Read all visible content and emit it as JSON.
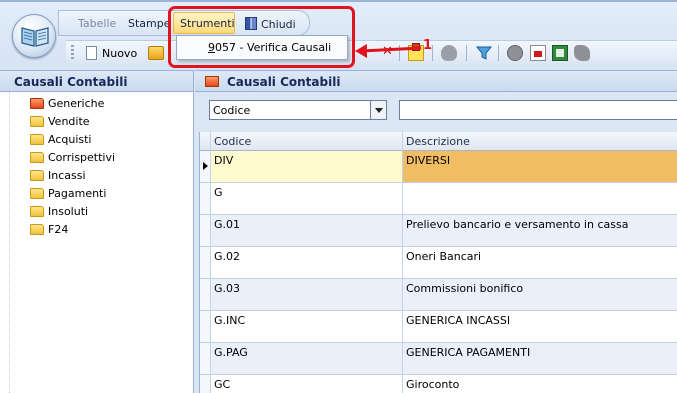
{
  "ribbon": {
    "tabs": [
      "Tabelle",
      "Stampe",
      "Strumenti",
      "Chiudi"
    ],
    "active_tab": "Strumenti"
  },
  "toolbar": {
    "new_label": "Nuovo"
  },
  "strumenti_menu": {
    "items": [
      "9057 - Verifica Causali"
    ]
  },
  "callout": {
    "number": "1",
    "color": "#e0131e"
  },
  "left_pane": {
    "title": "Causali Contabili",
    "items": [
      "Generiche",
      "Vendite",
      "Acquisti",
      "Corrispettivi",
      "Incassi",
      "Pagamenti",
      "Insoluti",
      "F24"
    ],
    "selected": "Generiche"
  },
  "main": {
    "title": "Causali Contabili",
    "filter_field": "Codice",
    "search_value": "",
    "columns": [
      "Codice",
      "Descrizione"
    ],
    "rows": [
      {
        "code": "DIV",
        "desc": "DIVERSI"
      },
      {
        "code": "G",
        "desc": ""
      },
      {
        "code": "G.01",
        "desc": "Prelievo bancario e versamento in cassa"
      },
      {
        "code": "G.02",
        "desc": "Oneri Bancari"
      },
      {
        "code": "G.03",
        "desc": "Commissioni bonifico"
      },
      {
        "code": "G.INC",
        "desc": "GENERICA INCASSI"
      },
      {
        "code": "G.PAG",
        "desc": "GENERICA PAGAMENTI"
      },
      {
        "code": "GC",
        "desc": "Giroconto"
      }
    ],
    "selected_row": 0,
    "selection_color": "#f0bd63"
  }
}
